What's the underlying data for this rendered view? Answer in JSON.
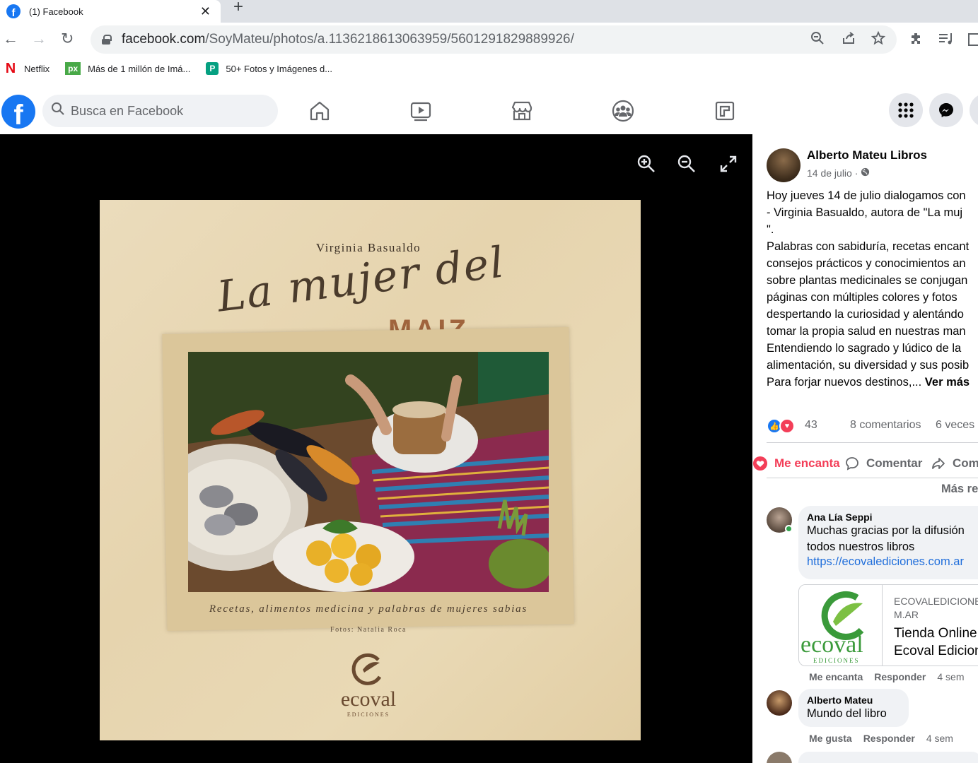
{
  "browser": {
    "tab_title": "(1) Facebook",
    "url_domain": "facebook.com",
    "url_path": "/SoyMateu/photos/a.1136218613063959/5601291829889926/",
    "bookmarks": [
      {
        "label": "Netflix",
        "icon": "netflix-icon",
        "color": "#e50914"
      },
      {
        "label": "Más de 1 millón de Imá...",
        "icon": "pixabay-icon",
        "color": "#48a947"
      },
      {
        "label": "50+ Fotos y Imágenes d...",
        "icon": "pexels-icon",
        "color": "#05a081"
      }
    ]
  },
  "facebook": {
    "search_placeholder": "Busca en Facebook",
    "brand_color": "#1877f2"
  },
  "photo": {
    "author": "Virginia Basualdo",
    "script_title": "La mujer del",
    "title_word": "MAIZ",
    "subtitle": "Recetas, alimentos medicina y palabras de mujeres sabias",
    "credits": "Fotos: Natalia Roca",
    "brand": "ecoval",
    "brand_sub": "EDICIONES"
  },
  "post": {
    "author": "Alberto Mateu Libros",
    "date": "14 de julio · ",
    "text_lines": [
      "Hoy jueves 14 de julio dialogamos con",
      "- Virginia Basualdo, autora de \"La muj",
      "\".",
      "Palabras con sabiduría, recetas encant",
      "consejos prácticos y conocimientos an",
      "sobre plantas medicinales se conjugan",
      "páginas con múltiples colores y fotos",
      "despertando la curiosidad y alentándo",
      "tomar la propia salud en nuestras man",
      "Entendiendo lo sagrado y lúdico de la",
      "alimentación, su diversidad y sus posib"
    ],
    "last_line": "Para forjar nuevos destinos,...",
    "see_more": "Ver más",
    "reaction_count": "43",
    "comments_count": "8 comentarios",
    "shares_count": "6 veces",
    "action_love": "Me encanta",
    "action_comment": "Comentar",
    "action_share": "Com",
    "most_relevant": "Más re"
  },
  "comments": [
    {
      "name": "Ana Lía Seppi",
      "lines": [
        "Muchas gracias por la difusión",
        "todos nuestros libros"
      ],
      "link": "https://ecovalediciones.com.ar",
      "preview_domain": "ECOVALEDICIONES.COM.AR",
      "preview_domain_l1": "ECOVALEDICIONE",
      "preview_domain_l2": "M.AR",
      "preview_title_l1": "Tienda Online",
      "preview_title_l2": "Ecoval Edicion",
      "preview_logo_text": "ecoval",
      "preview_logo_sub": "EDICIONES",
      "like": "Me encanta",
      "reply": "Responder",
      "time": "4 sem"
    },
    {
      "name": "Alberto Mateu",
      "lines": [
        "Mundo del libro"
      ],
      "like": "Me gusta",
      "reply": "Responder",
      "time": "4 sem"
    }
  ]
}
